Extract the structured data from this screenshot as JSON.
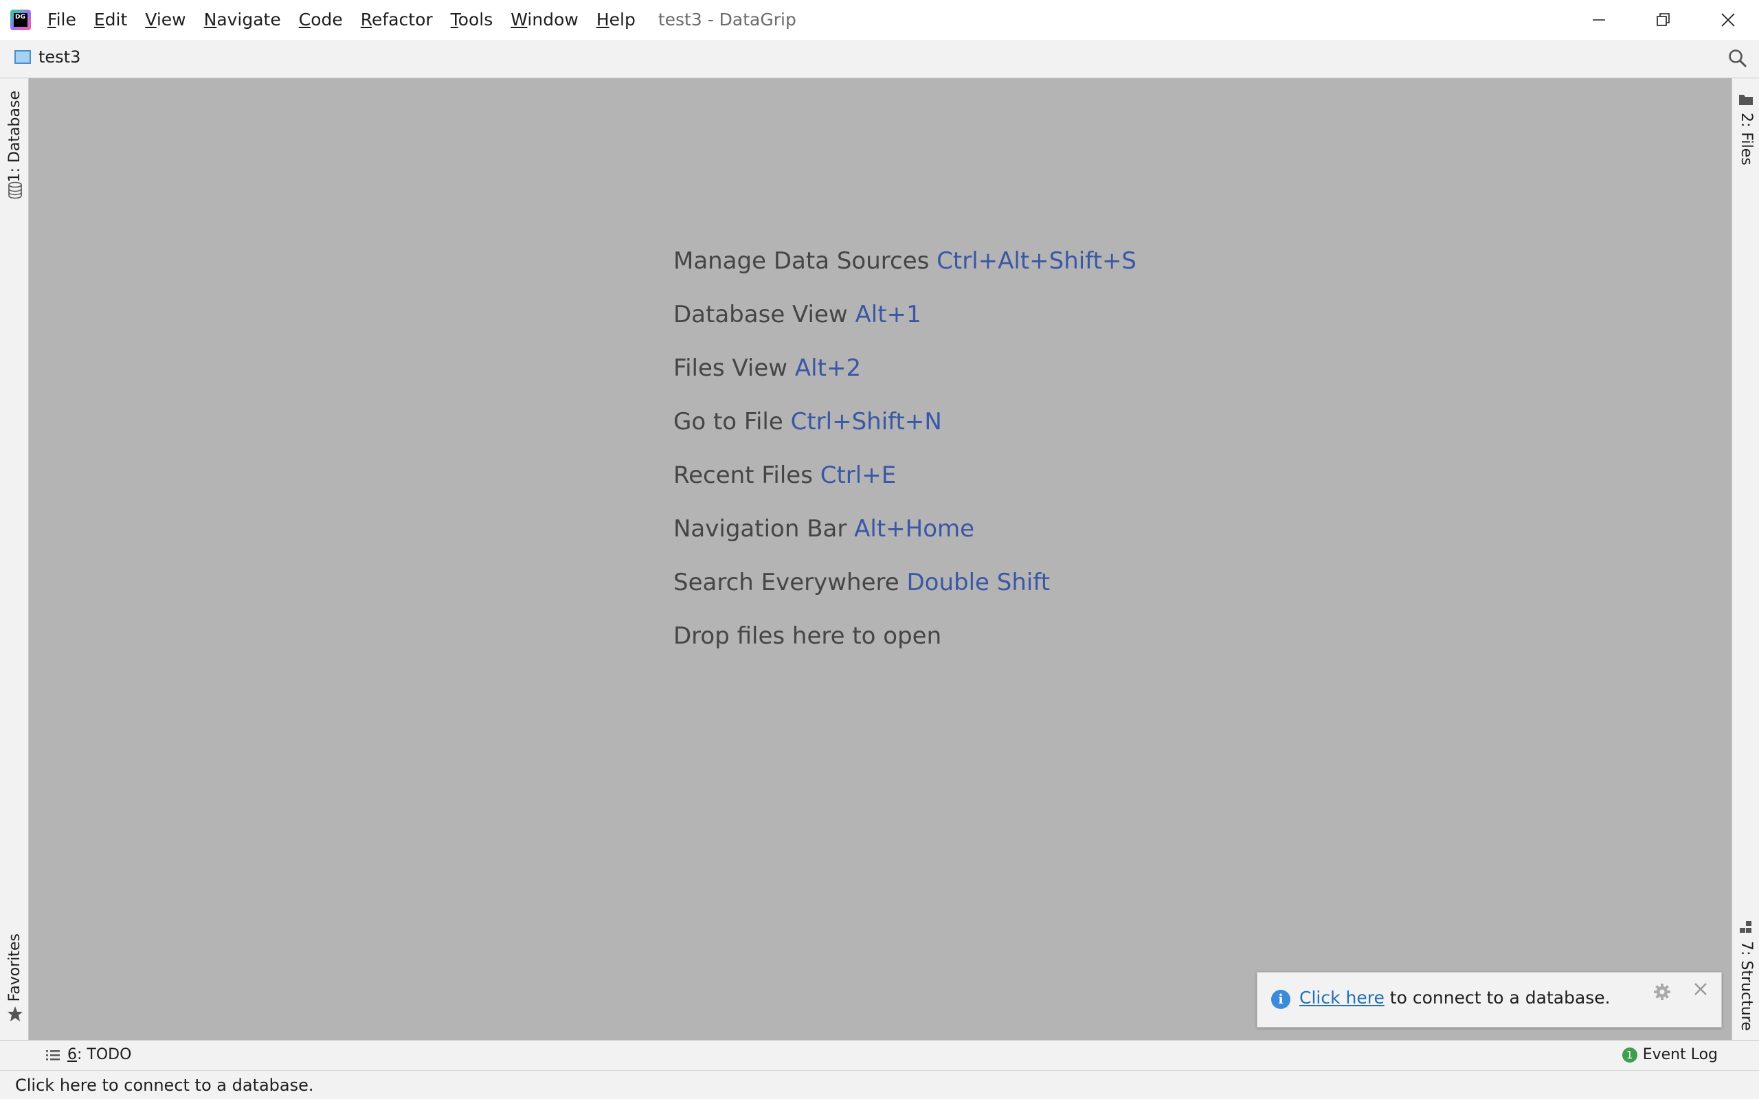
{
  "app": {
    "logo_text": "DG",
    "window_title": "test3 - DataGrip"
  },
  "menu": [
    {
      "mnemonic": "F",
      "rest": "ile"
    },
    {
      "mnemonic": "E",
      "rest": "dit"
    },
    {
      "mnemonic": "V",
      "rest": "iew"
    },
    {
      "mnemonic": "N",
      "rest": "avigate"
    },
    {
      "mnemonic": "C",
      "rest": "ode"
    },
    {
      "mnemonic": "R",
      "rest": "efactor"
    },
    {
      "mnemonic": "T",
      "rest": "ools"
    },
    {
      "mnemonic": "W",
      "rest": "indow"
    },
    {
      "mnemonic": "H",
      "rest": "elp"
    }
  ],
  "navbar": {
    "project": "test3"
  },
  "side_tabs": {
    "database": "1: Database",
    "favorites": "Favorites",
    "files": "2: Files",
    "structure": "7: Structure"
  },
  "hints": [
    {
      "label": "Manage Data Sources",
      "key": "Ctrl+Alt+Shift+S"
    },
    {
      "label": "Database View",
      "key": "Alt+1"
    },
    {
      "label": "Files View",
      "key": "Alt+2"
    },
    {
      "label": "Go to File",
      "key": "Ctrl+Shift+N"
    },
    {
      "label": "Recent Files",
      "key": "Ctrl+E"
    },
    {
      "label": "Navigation Bar",
      "key": "Alt+Home"
    },
    {
      "label": "Search Everywhere",
      "key": "Double Shift"
    },
    {
      "label": "Drop files here to open",
      "key": ""
    }
  ],
  "notification": {
    "link": "Click here",
    "text": " to connect to a database."
  },
  "toolstrip": {
    "todo_mnemonic": "6",
    "todo_rest": ": TODO",
    "event_log": "Event Log",
    "event_count": "1"
  },
  "status": {
    "text": "Click here to connect to a database."
  },
  "colors": {
    "editor_bg": "#b4b4b4",
    "hint_text": "#454545",
    "shortcut": "#3a57a6",
    "link": "#2470b3"
  }
}
